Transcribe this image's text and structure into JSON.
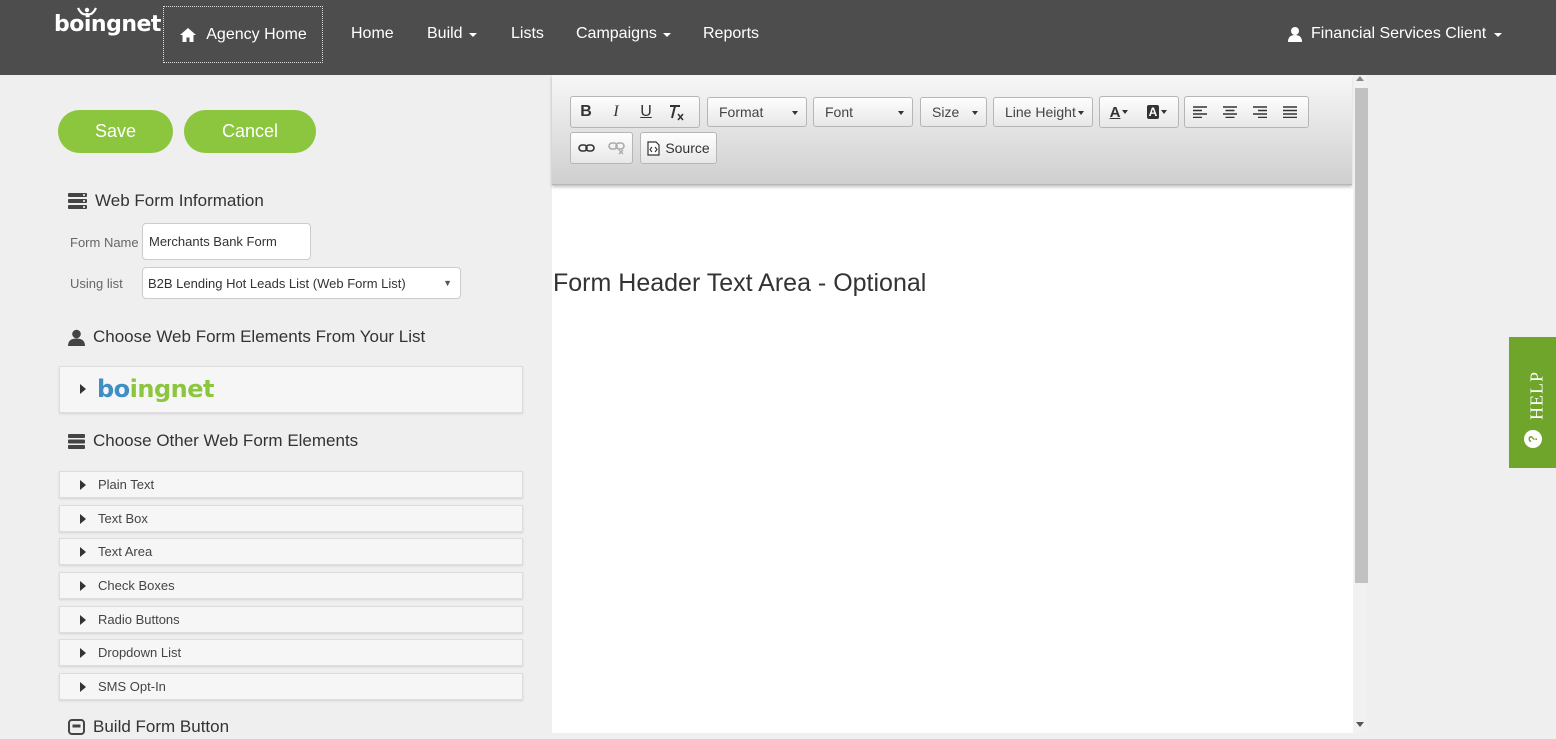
{
  "brand": {
    "logo_text": "boingnet"
  },
  "navbar": {
    "agency_home": "Agency Home",
    "items": [
      {
        "label": "Home",
        "has_caret": false
      },
      {
        "label": "Build",
        "has_caret": true
      },
      {
        "label": "Lists",
        "has_caret": false
      },
      {
        "label": "Campaigns",
        "has_caret": true
      },
      {
        "label": "Reports",
        "has_caret": false
      }
    ],
    "user": "Financial Services Client"
  },
  "actions": {
    "save": "Save",
    "cancel": "Cancel"
  },
  "web_form_info": {
    "heading": "Web Form Information",
    "form_name_label": "Form Name",
    "form_name_value": "Merchants Bank Form",
    "using_list_label": "Using list",
    "using_list_value": "B2B Lending Hot Leads List (Web Form List)"
  },
  "list_elements": {
    "heading": "Choose Web Form Elements From Your List",
    "logo_text": "boingnet"
  },
  "other_elements": {
    "heading": "Choose Other Web Form Elements",
    "items": [
      "Plain Text",
      "Text Box",
      "Text Area",
      "Check Boxes",
      "Radio Buttons",
      "Dropdown List",
      "SMS Opt-In"
    ]
  },
  "build_button": {
    "heading": "Build Form Button"
  },
  "editor": {
    "format": "Format",
    "font": "Font",
    "size": "Size",
    "line_height": "Line Height",
    "source": "Source",
    "content": "Form Header Text Area - Optional"
  },
  "help": {
    "label": "HELP"
  },
  "colors": {
    "navbar": "#4d4d4d",
    "green": "#8cc63f",
    "help": "#6ea52a"
  }
}
